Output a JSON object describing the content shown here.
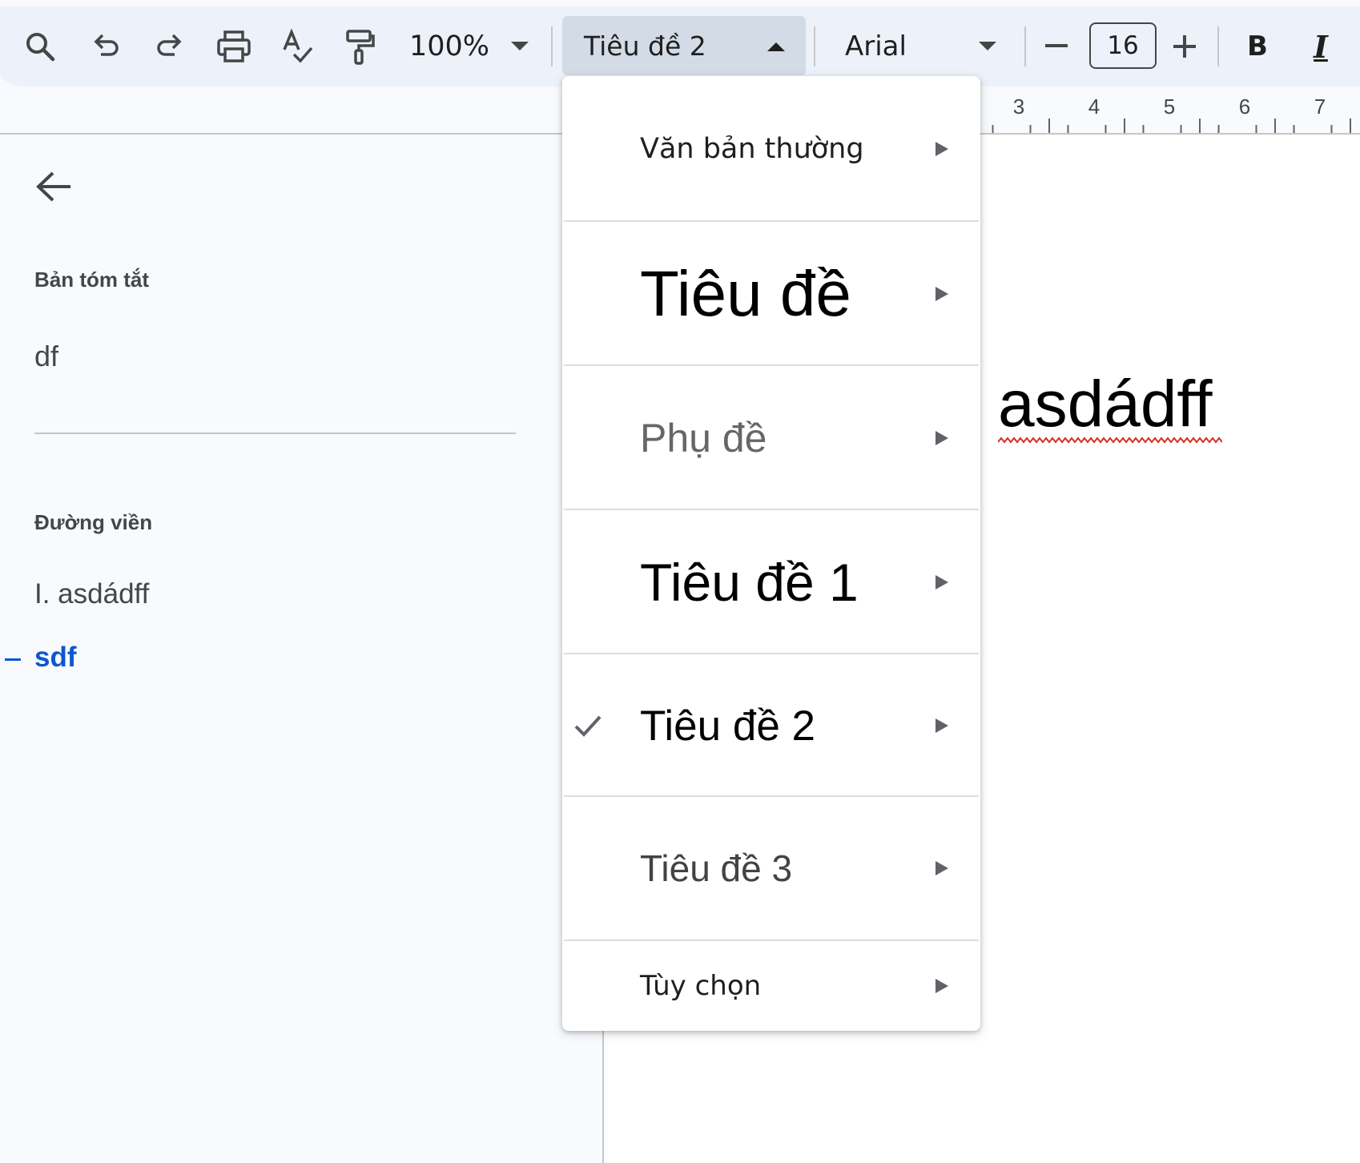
{
  "toolbar": {
    "zoom": "100%",
    "paragraph_style": "Tiêu đề 2",
    "font_family": "Arial",
    "font_size": "16",
    "bold_label": "B",
    "italic_label": "I",
    "icons": [
      "search-icon",
      "undo-icon",
      "redo-icon",
      "print-icon",
      "spellcheck-icon",
      "paint-format-icon",
      "dropdown-caret-icon",
      "decrease-font-size-icon",
      "increase-font-size-icon",
      "bold-icon",
      "italic-icon"
    ]
  },
  "ruler": {
    "numbers": [
      "3",
      "4",
      "5",
      "6",
      "7"
    ]
  },
  "sidebar": {
    "summary_heading": "Bản tóm tắt",
    "summary_text": "df",
    "outline_heading": "Đường viền",
    "outline_items": [
      "I. asdádff",
      "sdf"
    ],
    "active_color": "#0b57d0"
  },
  "document": {
    "heading_text": "asdádff"
  },
  "style_menu": {
    "items": [
      {
        "label": "Văn bản thường",
        "checked": false
      },
      {
        "label": "Tiêu đề",
        "checked": false
      },
      {
        "label": "Phụ đề",
        "checked": false
      },
      {
        "label": "Tiêu đề 1",
        "checked": false
      },
      {
        "label": "Tiêu đề 2",
        "checked": true
      },
      {
        "label": "Tiêu đề 3",
        "checked": false
      },
      {
        "label": "Tùy chọn",
        "checked": false
      }
    ]
  }
}
